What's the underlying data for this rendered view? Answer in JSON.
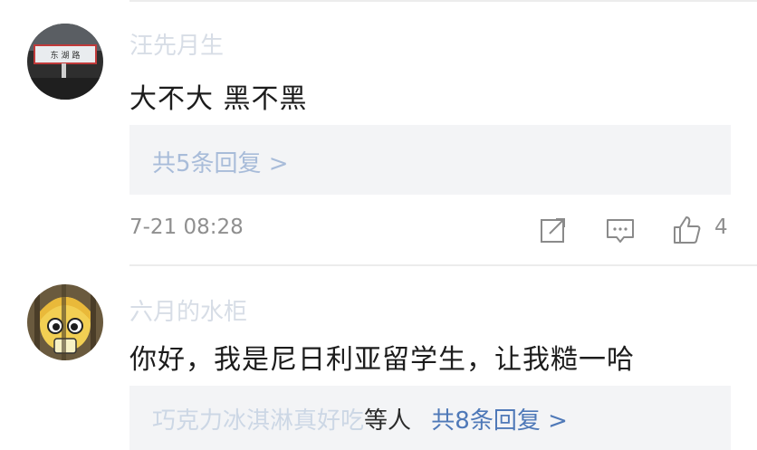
{
  "comments": [
    {
      "username": "汪先月生",
      "text": "大不大 黑不黑",
      "replies": {
        "summary": "共5条回复 >"
      },
      "timestamp": "7-21 08:28",
      "likes": "4",
      "avatar_sign_text": "东 湖 路"
    },
    {
      "username": "六月的水柜",
      "text": "你好，我是尼日利亚留学生，让我糙一哈",
      "replies": {
        "preview_faded": "巧克力冰淇淋真好吃",
        "preview_dark": "等人",
        "summary": "共8条回复 >"
      }
    }
  ],
  "icons": {
    "share": "share-icon",
    "comment": "comment-icon",
    "like": "thumbs-up-icon"
  },
  "colors": {
    "link": "#4f79b8",
    "meta": "#8f8f8f",
    "reply_bg": "#f3f4f6"
  }
}
